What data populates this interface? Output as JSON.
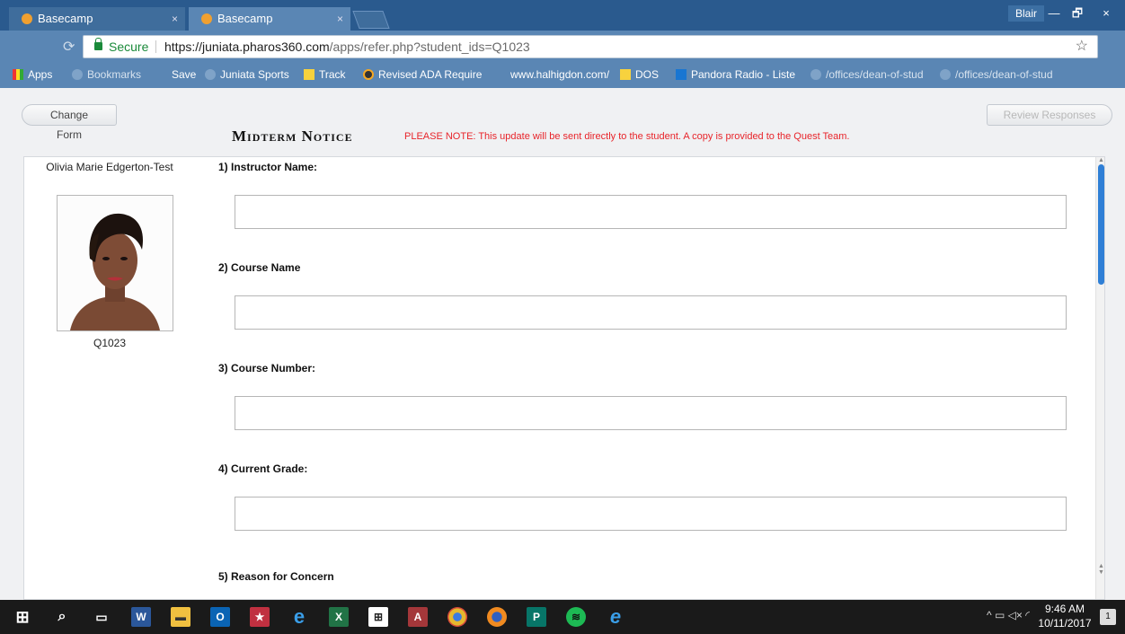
{
  "browser": {
    "tabs": [
      {
        "title": "Basecamp",
        "close": "×"
      },
      {
        "title": "Basecamp",
        "close": "×"
      }
    ],
    "window_user": "Blair",
    "window_buttons": {
      "minimize": "—",
      "maximize": "🗗",
      "close": "×"
    },
    "address": {
      "secure_label": "Secure",
      "url_host": "https://juniata.pharos360.com",
      "url_path": "/apps/refer.php?student_ids=Q1023"
    },
    "bookmarks": [
      {
        "label": "Apps",
        "icon": "apps-icon"
      },
      {
        "label": "Bookmarks",
        "icon": "folder-icon"
      },
      {
        "label": "Save",
        "icon": "none"
      },
      {
        "label": "Juniata Sports",
        "icon": "juniata-icon"
      },
      {
        "label": "Track",
        "icon": "folder-icon"
      },
      {
        "label": "Revised ADA Require",
        "icon": "ada-icon"
      },
      {
        "label": "www.halhigdon.com/",
        "icon": "globe-icon"
      },
      {
        "label": "DOS",
        "icon": "folder-icon"
      },
      {
        "label": "Pandora Radio - Liste",
        "icon": "pandora-icon"
      },
      {
        "label": "/offices/dean-of-stud",
        "icon": "juniata-icon"
      },
      {
        "label": "/offices/dean-of-stud",
        "icon": "juniata-icon"
      }
    ]
  },
  "page": {
    "change_form_label": "Change Form",
    "review_responses_label": "Review Responses",
    "form_title": "Midterm Notice",
    "notice_text": "PLEASE NOTE: This update will be sent directly to the student. A copy is provided to the Quest Team.",
    "student": {
      "name": "Olivia Marie Edgerton-Test",
      "id": "Q1023"
    },
    "questions": [
      {
        "label": "1)  Instructor Name:",
        "value": ""
      },
      {
        "label": "2)  Course Name",
        "value": ""
      },
      {
        "label": "3)  Course Number:",
        "value": ""
      },
      {
        "label": "4)  Current Grade:",
        "value": ""
      },
      {
        "label": "5)  Reason for Concern"
      }
    ]
  },
  "taskbar": {
    "clock_time": "9:46 AM",
    "clock_date": "10/11/2017",
    "notification_count": "1"
  },
  "colors": {
    "titlebar": "#2a5a8e",
    "toolbar": "#5a86b4",
    "notice_red": "#e8242a",
    "scroll_thumb": "#2f7fd6"
  }
}
